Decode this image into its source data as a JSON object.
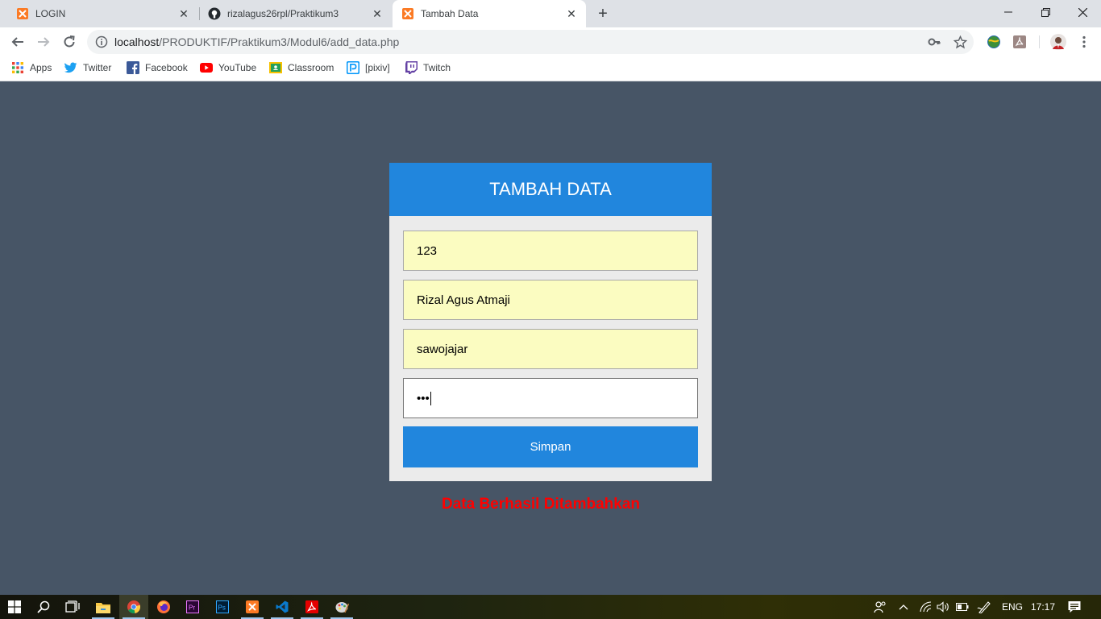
{
  "tabs": [
    {
      "title": "LOGIN",
      "icon": "xampp-icon"
    },
    {
      "title": "rizalagus26rpl/Praktikum3",
      "icon": "github-icon"
    },
    {
      "title": "Tambah Data",
      "icon": "xampp-icon",
      "active": true
    }
  ],
  "address": {
    "host": "localhost",
    "path": "/PRODUKTIF/Praktikum3/Modul6/add_data.php"
  },
  "bookmarks": [
    {
      "label": "Apps",
      "icon": "apps-grid-icon"
    },
    {
      "label": "Twitter",
      "icon": "twitter-icon"
    },
    {
      "label": "Facebook",
      "icon": "facebook-icon"
    },
    {
      "label": "YouTube",
      "icon": "youtube-icon"
    },
    {
      "label": "Classroom",
      "icon": "classroom-icon"
    },
    {
      "label": "[pixiv]",
      "icon": "pixiv-icon"
    },
    {
      "label": "Twitch",
      "icon": "twitch-icon"
    }
  ],
  "form": {
    "title": "TAMBAH DATA",
    "fields": [
      "123",
      "Rizal Agus Atmaji",
      "sawojajar"
    ],
    "password_mask": "•••",
    "submit_label": "Simpan"
  },
  "message": "Data Berhasil Ditambahkan",
  "colors": {
    "page_bg": "#475566",
    "accent": "#2186dd",
    "autofill_bg": "#fbfcc1",
    "message": "#ff0000"
  },
  "taskbar": {
    "language": "ENG",
    "time": "17:17"
  }
}
